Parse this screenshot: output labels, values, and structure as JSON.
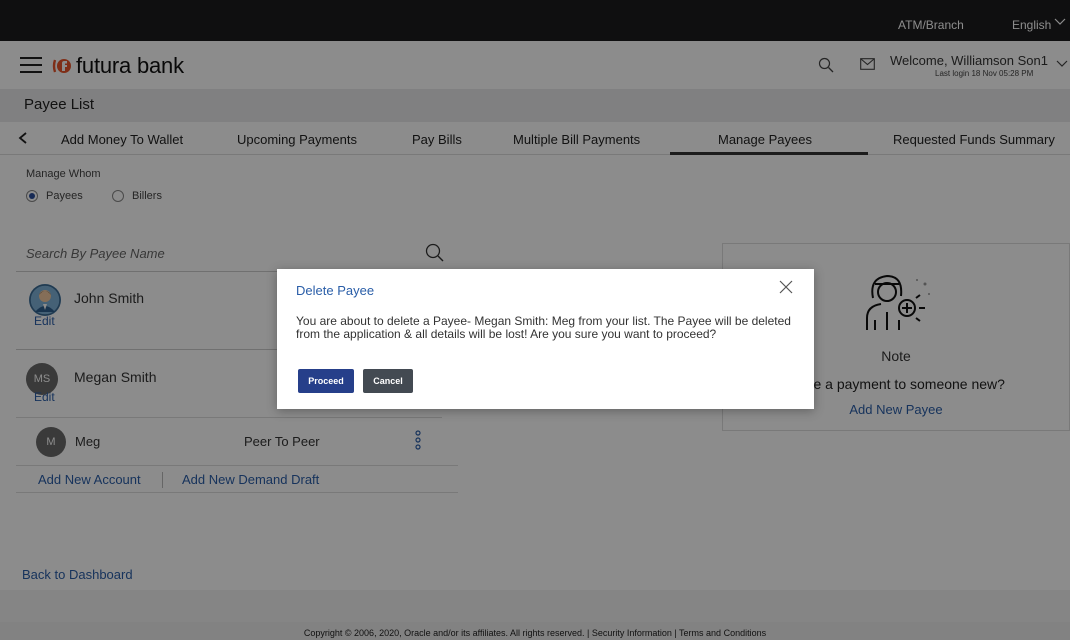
{
  "topbar": {
    "atm_branch": "ATM/Branch",
    "language": "English"
  },
  "header": {
    "brand": "futura bank",
    "welcome": "Welcome, Williamson Son1",
    "last_login": "Last login 18 Nov 05:28 PM"
  },
  "page": {
    "title": "Payee List"
  },
  "tabs": [
    {
      "label": "Add Money To Wallet"
    },
    {
      "label": "Upcoming Payments"
    },
    {
      "label": "Pay Bills"
    },
    {
      "label": "Multiple Bill Payments"
    },
    {
      "label": "Manage Payees",
      "active": true
    },
    {
      "label": "Requested Funds Summary"
    }
  ],
  "manage_whom": {
    "label": "Manage Whom",
    "options": [
      {
        "label": "Payees",
        "selected": true
      },
      {
        "label": "Billers",
        "selected": false
      }
    ]
  },
  "search": {
    "placeholder": "Search By Payee Name",
    "value": ""
  },
  "payees": [
    {
      "name": "John Smith",
      "initials": "",
      "edit_label": "Edit"
    },
    {
      "name": "Megan Smith",
      "initials": "MS",
      "edit_label": "Edit"
    }
  ],
  "account": {
    "initial": "M",
    "name": "Meg",
    "type": "Peer To Peer"
  },
  "account_links": {
    "add_account": "Add New Account",
    "add_draft": "Add New Demand Draft"
  },
  "note": {
    "title": "Note",
    "text": "make a payment to someone new?",
    "link": "Add New Payee"
  },
  "back_link": "Back to Dashboard",
  "footer": "Copyright © 2006, 2020, Oracle and/or its affiliates. All rights reserved. | Security Information | Terms and Conditions",
  "modal": {
    "title": "Delete Payee",
    "body": "You are about to delete a Payee- Megan Smith: Meg from your list. The Payee will be deleted from the application & all details will be lost! Are you sure you want to proceed?",
    "proceed_label": "Proceed",
    "cancel_label": "Cancel"
  },
  "colors": {
    "link": "#2a5ea8",
    "primary_button": "#263f8a",
    "secondary_button": "#434a52",
    "topbar": "#1c1c1e",
    "logo_orange": "#e8542a"
  }
}
